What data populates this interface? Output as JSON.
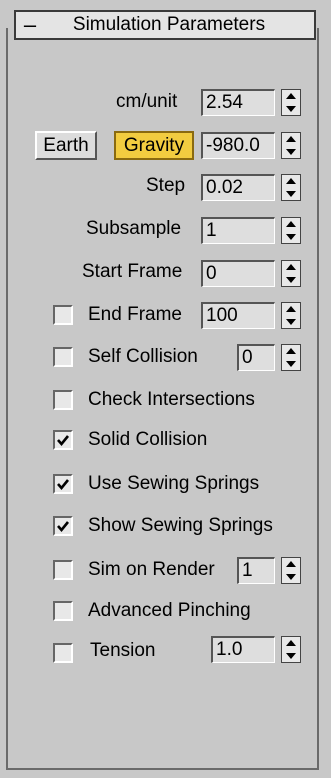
{
  "header": {
    "toggle": "–",
    "title": "Simulation Parameters"
  },
  "params": {
    "cm_unit": {
      "label": "cm/unit",
      "value": "2.54"
    },
    "earth_button": "Earth",
    "gravity": {
      "label": "Gravity",
      "value": "-980.0"
    },
    "step": {
      "label": "Step",
      "value": "0.02"
    },
    "subsample": {
      "label": "Subsample",
      "value": "1"
    },
    "start_frame": {
      "label": "Start Frame",
      "value": "0"
    },
    "end_frame": {
      "label": "End Frame",
      "value": "100",
      "checked": false
    },
    "self_collision": {
      "label": "Self Collision",
      "value": "0",
      "checked": false
    },
    "check_intersections": {
      "label": "Check Intersections",
      "checked": false
    },
    "solid_collision": {
      "label": "Solid Collision",
      "checked": true
    },
    "use_sewing_springs": {
      "label": "Use Sewing Springs",
      "checked": true
    },
    "show_sewing_springs": {
      "label": "Show Sewing Springs",
      "checked": true
    },
    "sim_on_render": {
      "label": "Sim on Render",
      "value": "1",
      "checked": false
    },
    "advanced_pinching": {
      "label": "Advanced Pinching",
      "checked": false
    },
    "tension": {
      "label": "Tension",
      "value": "1.0",
      "checked": false
    }
  },
  "colors": {
    "active_button": "#f2cc40",
    "panel_bg": "#c8c8c8"
  }
}
